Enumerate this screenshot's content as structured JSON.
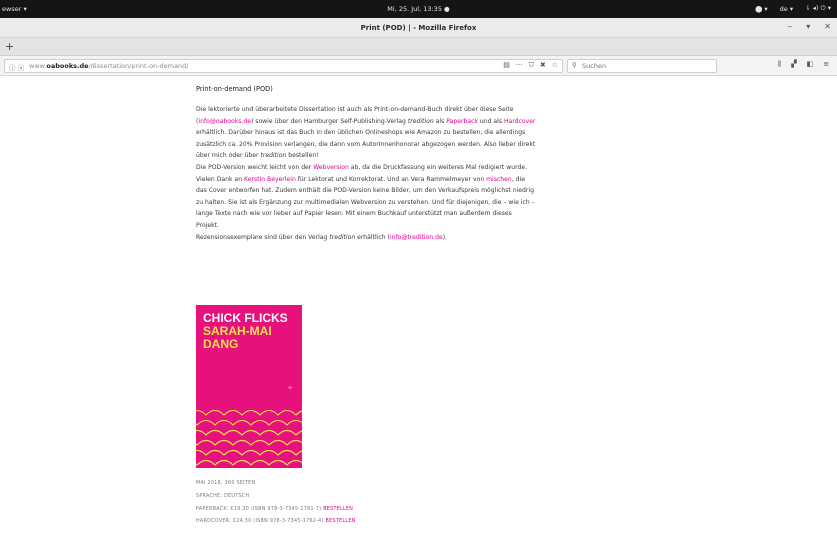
{
  "topbar": {
    "app_menu": "ewser ▾",
    "clock": "Mi, 25. Jul, 13:35 ●",
    "indicators": [
      "⬤ ▾",
      "de ▾",
      "⇂ ◂) ⏻ ▾"
    ]
  },
  "window": {
    "title": "Print (POD) | - Mozilla Firefox",
    "controls": [
      "‒",
      "▾",
      "✕"
    ]
  },
  "tabs": {
    "new_tab": "+"
  },
  "urlbar": {
    "info": "ⓘ ⓤ",
    "url_prefix": "www.",
    "url_domain": "oabooks.de",
    "url_path": "/dissertation/print-on-demand/",
    "actions": [
      "▤",
      "···",
      "⛉",
      "✖",
      "☆"
    ]
  },
  "search": {
    "placeholder": "Suchen",
    "icon": "search-icon"
  },
  "toolbar_icons": [
    "library-icon",
    "extension-icon",
    "sidebar-icon",
    "menu-icon"
  ],
  "toolbar_glyphs": [
    "⫼",
    "▞",
    "◧",
    "≡"
  ],
  "content": {
    "heading": "Print-on-demand (POD)",
    "p1_a": "Die lektorierte und überarbeitete Dissertation ist auch als Print-on-demand-Buch direkt über diese Seite (",
    "p1_link1": "info@oabooks.de",
    "p1_b": ") sowie über den Hamburger Self-Publishing-Verlag ",
    "p1_italic": "tredition",
    "p1_c": " als ",
    "p1_link2": "Paperback",
    "p1_d": " und als ",
    "p1_link3": "Hardcover",
    "p1_e": " erhältlich. Darüber hinaus ist das Buch in den üblichen Onlineshops wie Amazon zu bestellen, die allerdings zusätzlich ca. 20% Provision verlangen, die dann vom AutorInnenhonorar abgezogen werden. Also lieber direkt über mich oder über ",
    "p1_italic2": "tredition",
    "p1_f": " bestellen!",
    "p2_a": "Die POD-Version weicht leicht von der ",
    "p2_link1": "Webversion",
    "p2_b": " ab, da die Druckfassung ein weiteres Mal redigiert wurde. Vielen Dank an ",
    "p2_link2": "Kerstin Beyerlein",
    "p2_c": " für Lektorat und Korrektorat. Und an Vera Rammelmeyer von ",
    "p2_link3": "mischen",
    "p2_d": ", die das Cover entworfen hat. Zudem enthält die POD-Version keine Bilder, um den Verkaufspreis möglichst niedrig zu halten. Sie ist als Ergänzung zur multimedialen Webversion zu verstehen. Und für diejenigen, die – wie ich – lange Texte nach wie vor lieber auf Papier lesen. Mit einem Buchkauf unterstützt man außerdem dieses Projekt.",
    "p3_a": "Rezensionsexemplare sind über den Verlag ",
    "p3_italic": "tredition",
    "p3_b": " erhältlich (",
    "p3_link": "info@tredition.de",
    "p3_c": ")."
  },
  "cover": {
    "title": "CHICK FLICKS",
    "author": "SARAH-MAI DANG",
    "publisher_mark": "∞",
    "colors": {
      "background": "#e6117d",
      "title": "#ffffff",
      "author": "#f6e24a",
      "arcs": "#f6e24a"
    }
  },
  "meta": {
    "line1": "Mai 2018, 360 Seiten",
    "line2": "Sprache: Deutsch",
    "paperback_text": "Paperback: €19,30 (ISBN 978-3-7345-1761-7) ",
    "paperback_link": "Bestellen",
    "hardcover_text": "Hardcover: €24,30 (ISBN 978-3-7345-1762-4) ",
    "hardcover_link": "Bestellen"
  }
}
